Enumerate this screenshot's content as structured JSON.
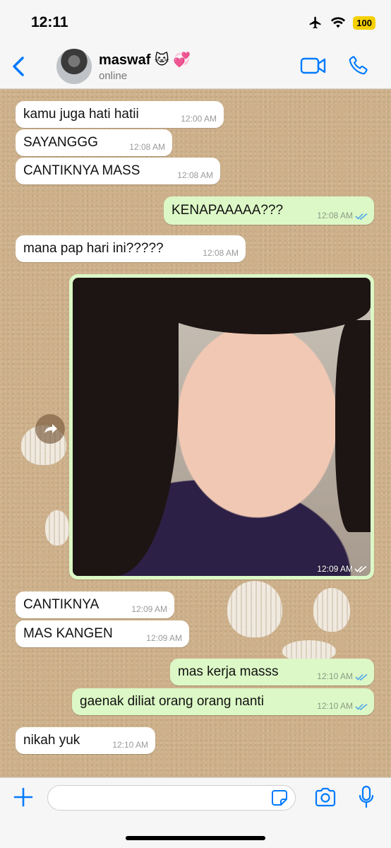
{
  "status_bar": {
    "time": "12:11",
    "battery": "100"
  },
  "header": {
    "contact_name": "maswaf 🐱 💞",
    "status": "online"
  },
  "messages": [
    {
      "direction": "in",
      "text": "kamu juga hati hatii",
      "time": "12:00 AM"
    },
    {
      "direction": "in",
      "text": "SAYANGGG",
      "time": "12:08 AM"
    },
    {
      "direction": "in",
      "text": "CANTIKNYA MASS",
      "time": "12:08 AM"
    },
    {
      "direction": "out",
      "text": "KENAPAAAAA???",
      "time": "12:08 AM"
    },
    {
      "direction": "in",
      "text": "mana pap hari ini?????",
      "time": "12:08 AM"
    },
    {
      "direction": "out",
      "type": "photo",
      "time": "12:09 AM"
    },
    {
      "direction": "in",
      "text": "CANTIKNYA",
      "time": "12:09 AM"
    },
    {
      "direction": "in",
      "text": "MAS KANGEN",
      "time": "12:09 AM"
    },
    {
      "direction": "out",
      "text": "mas kerja masss",
      "time": "12:10 AM"
    },
    {
      "direction": "out",
      "text": "gaenak diliat orang orang nanti",
      "time": "12:10 AM"
    },
    {
      "direction": "in",
      "text": "nikah yuk",
      "time": "12:10 AM"
    }
  ],
  "input": {
    "placeholder": ""
  },
  "colors": {
    "accent": "#007aff",
    "outgoing_bubble": "#dcf8c6",
    "incoming_bubble": "#ffffff",
    "read_ticks": "#4fa8e8"
  }
}
